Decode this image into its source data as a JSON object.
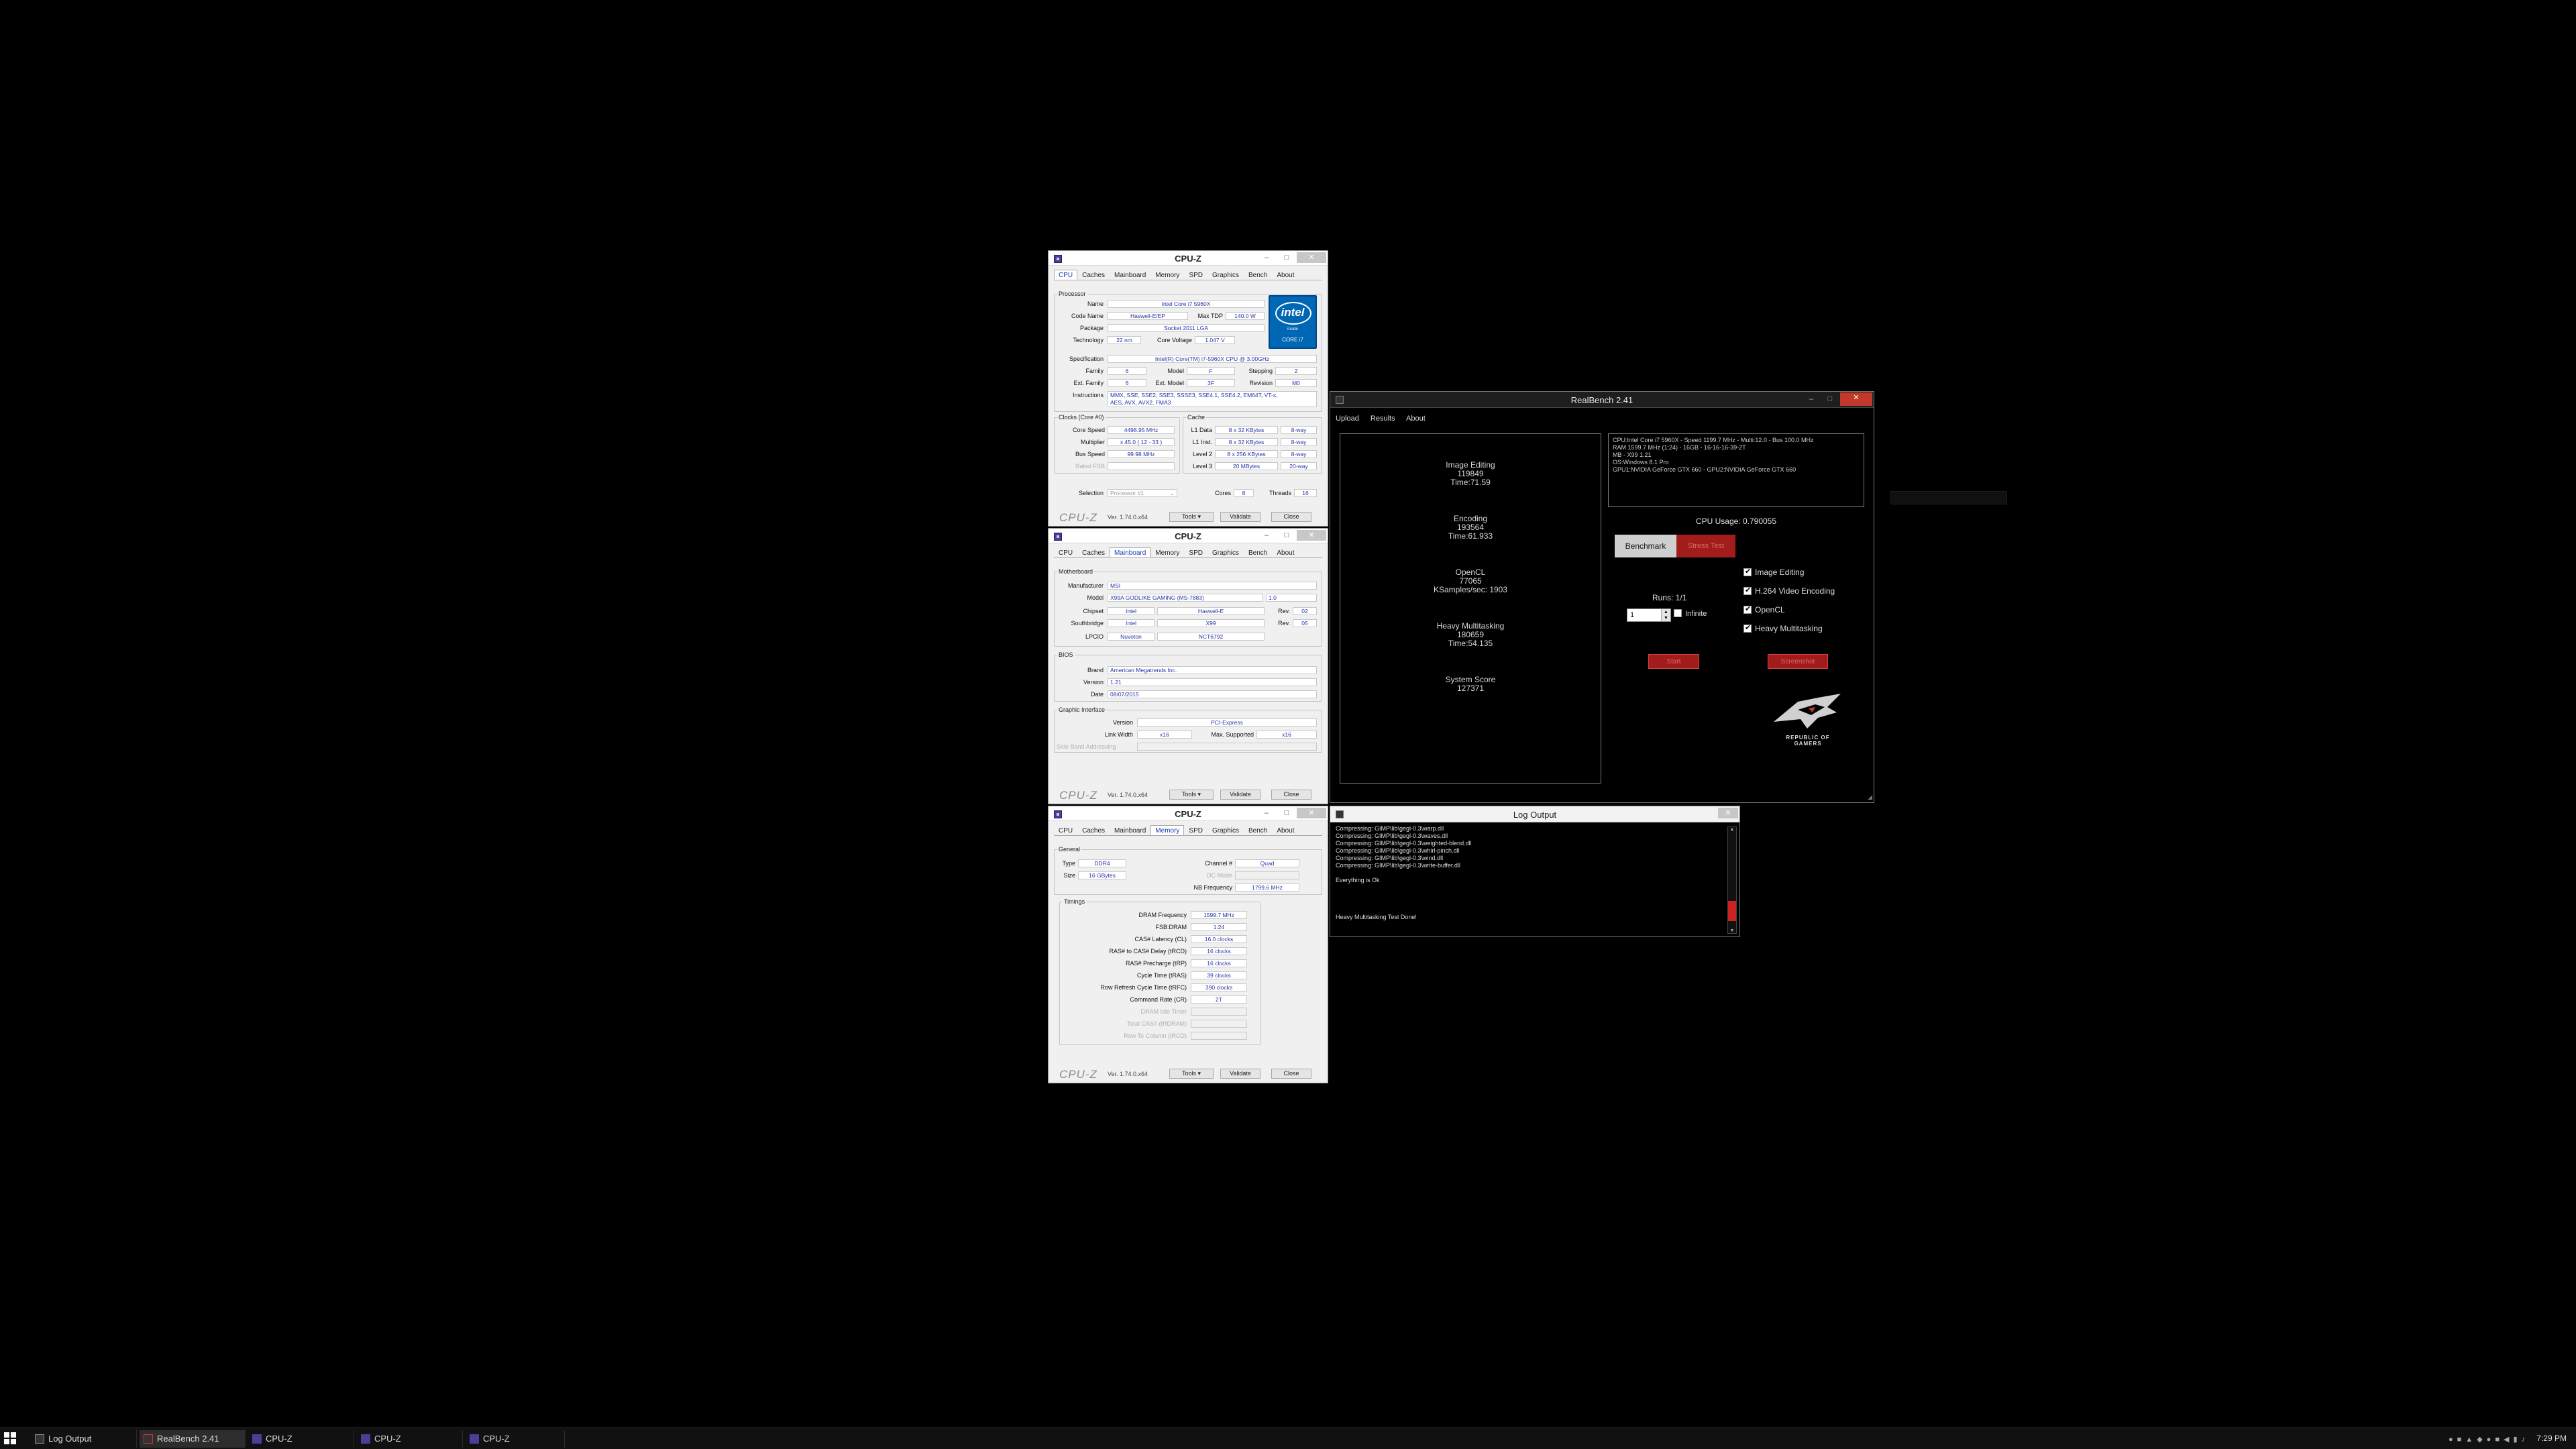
{
  "cpuz_common": {
    "title": "CPU-Z",
    "tabs": [
      "CPU",
      "Caches",
      "Mainboard",
      "Memory",
      "SPD",
      "Graphics",
      "Bench",
      "About"
    ],
    "brand": "CPU-Z",
    "version": "Ver. 1.74.0.x64",
    "tools": "Tools",
    "validate": "Validate",
    "close": "Close"
  },
  "cpu_window": {
    "processor": {
      "group": "Processor",
      "name_label": "Name",
      "name": "Intel Core i7 5960X",
      "codename_label": "Code Name",
      "codename": "Haswell-E/EP",
      "maxtdp_label": "Max TDP",
      "maxtdp": "140.0 W",
      "package_label": "Package",
      "package": "Socket 2011 LGA",
      "tech_label": "Technology",
      "tech": "22 nm",
      "voltage_label": "Core Voltage",
      "voltage": "1.047 V",
      "spec_label": "Specification",
      "spec": "Intel(R) Core(TM) i7-5960X CPU @ 3.00GHz",
      "family_label": "Family",
      "family": "6",
      "model_label": "Model",
      "model": "F",
      "stepping_label": "Stepping",
      "stepping": "2",
      "extfamily_label": "Ext. Family",
      "extfamily": "6",
      "extmodel_label": "Ext. Model",
      "extmodel": "3F",
      "revision_label": "Revision",
      "revision": "M0",
      "instr_label": "Instructions",
      "instr1": "MMX, SSE, SSE2, SSE3, SSSE3, SSE4.1, SSE4.2, EM64T, VT-x,",
      "instr2": "AES, AVX, AVX2, FMA3"
    },
    "intel_logo": {
      "word": "intel",
      "inside": "inside",
      "core": "CORE i7"
    },
    "clocks": {
      "group": "Clocks (Core #0)",
      "corespeed_label": "Core Speed",
      "corespeed": "4498.95 MHz",
      "mult_label": "Multiplier",
      "mult": "x 45.0 ( 12 - 33 )",
      "bus_label": "Bus Speed",
      "bus": "99.98 MHz",
      "fsb_label": "Rated FSB"
    },
    "cache": {
      "group": "Cache",
      "l1d_label": "L1 Data",
      "l1d": "8 x 32 KBytes",
      "l1d_way": "8-way",
      "l1i_label": "L1 Inst.",
      "l1i": "8 x 32 KBytes",
      "l1i_way": "8-way",
      "l2_label": "Level 2",
      "l2": "8 x 256 KBytes",
      "l2_way": "8-way",
      "l3_label": "Level 3",
      "l3": "20 MBytes",
      "l3_way": "20-way"
    },
    "selection_label": "Selection",
    "selection": "Processor #1",
    "cores_label": "Cores",
    "cores": "8",
    "threads_label": "Threads",
    "threads": "16"
  },
  "mb_window": {
    "mb": {
      "group": "Motherboard",
      "manuf_label": "Manufacturer",
      "manuf": "MSI",
      "model_label": "Model",
      "model": "X99A GODLIKE GAMING (MS-7883)",
      "model_rev": "1.0",
      "chipset_label": "Chipset",
      "chipset_v": "Intel",
      "chipset": "Haswell-E",
      "rev_label": "Rev.",
      "chipset_rev": "02",
      "south_label": "Southbridge",
      "south_v": "Intel",
      "south": "X99",
      "south_rev": "05",
      "lpcio_label": "LPCIO",
      "lpcio_v": "Nuvoton",
      "lpcio": "NCT6792"
    },
    "bios": {
      "group": "BIOS",
      "brand_label": "Brand",
      "brand": "American Megatrends Inc.",
      "version_label": "Version",
      "version": "1.21",
      "date_label": "Date",
      "date": "08/07/2015"
    },
    "gi": {
      "group": "Graphic Interface",
      "version_label": "Version",
      "version": "PCI-Express",
      "width_label": "Link Width",
      "width": "x16",
      "max_label": "Max. Supported",
      "max": "x16",
      "sba_label": "Side Band Addressing"
    }
  },
  "mem_window": {
    "general": {
      "group": "General",
      "type_label": "Type",
      "type": "DDR4",
      "channel_label": "Channel #",
      "channel": "Quad",
      "size_label": "Size",
      "size": "16 GBytes",
      "dc_label": "DC Mode",
      "nb_label": "NB Frequency",
      "nb": "1799.6 MHz"
    },
    "timings": {
      "group": "Timings",
      "rows": [
        {
          "label": "DRAM Frequency",
          "value": "1599.7 MHz",
          "dim": false
        },
        {
          "label": "FSB:DRAM",
          "value": "1:24",
          "dim": false
        },
        {
          "label": "CAS# Latency (CL)",
          "value": "16.0 clocks",
          "dim": false
        },
        {
          "label": "RAS# to CAS# Delay (tRCD)",
          "value": "16 clocks",
          "dim": false
        },
        {
          "label": "RAS# Precharge (tRP)",
          "value": "16 clocks",
          "dim": false
        },
        {
          "label": "Cycle Time (tRAS)",
          "value": "39 clocks",
          "dim": false
        },
        {
          "label": "Row Refresh Cycle Time (tRFC)",
          "value": "390 clocks",
          "dim": false
        },
        {
          "label": "Command Rate (CR)",
          "value": "2T",
          "dim": false
        },
        {
          "label": "DRAM Idle Timer",
          "value": "",
          "dim": true
        },
        {
          "label": "Total CAS# (tRDRAM)",
          "value": "",
          "dim": true
        },
        {
          "label": "Row To Column (tRCD)",
          "value": "",
          "dim": true
        }
      ]
    }
  },
  "realbench": {
    "title": "RealBench 2.41",
    "menu": [
      "Upload",
      "Results",
      "About"
    ],
    "results": [
      [
        "Image Editing",
        "119849",
        "Time:71.59"
      ],
      [
        "Encoding",
        "193564",
        "Time:61.933"
      ],
      [
        "OpenCL",
        "77065",
        "KSamples/sec: 1903"
      ],
      [
        "Heavy Multitasking",
        "180659",
        "Time:54.135"
      ],
      [
        "System Score",
        "127371"
      ]
    ],
    "sysinfo": [
      "CPU:Intel Core i7 5960X - Speed 1199.7 MHz - Multi:12.0 - Bus 100.0 MHz",
      "RAM 1599.7 MHz (1:24) - 16GB - 16-16-16-39-2T",
      "MB - X99 1.21",
      "OS:Windows 8.1 Pro",
      "GPU1:NVIDIA GeForce GTX 660 - GPU2:NVIDIA GeForce GTX 660"
    ],
    "cpu_usage": "CPU Usage: 0.790055",
    "benchmark": "Benchmark",
    "stress": "Stress Test",
    "runs": "Runs: 1/1",
    "runs_value": "1",
    "infinite": "Infinite",
    "options": [
      {
        "label": "Image Editing",
        "checked": true
      },
      {
        "label": "H.264 Video Encoding",
        "checked": true
      },
      {
        "label": "OpenCL",
        "checked": true
      },
      {
        "label": "Heavy Multitasking",
        "checked": true
      }
    ],
    "start": "Start",
    "screenshot": "Screenshot",
    "rog_line1": "REPUBLIC OF",
    "rog_line2": "GAMERS"
  },
  "log": {
    "title": "Log Output",
    "lines": [
      "Compressing: GIMP\\lib\\gegl-0.3\\warp.dll",
      "Compressing: GIMP\\lib\\gegl-0.3\\waves.dll",
      "Compressing: GIMP\\lib\\gegl-0.3\\weighted-blend.dll",
      "Compressing: GIMP\\lib\\gegl-0.3\\whirl-pinch.dll",
      "Compressing: GIMP\\lib\\gegl-0.3\\wind.dll",
      "Compressing: GIMP\\lib\\gegl-0.3\\write-buffer.dll",
      "",
      "Everything is Ok",
      "",
      "",
      "",
      "",
      "Heavy Multitasking Test Done!"
    ]
  },
  "taskbar": {
    "items": [
      "Log Output",
      "RealBench 2.41",
      "CPU-Z",
      "CPU-Z",
      "CPU-Z"
    ],
    "clock": "7:29 PM"
  }
}
